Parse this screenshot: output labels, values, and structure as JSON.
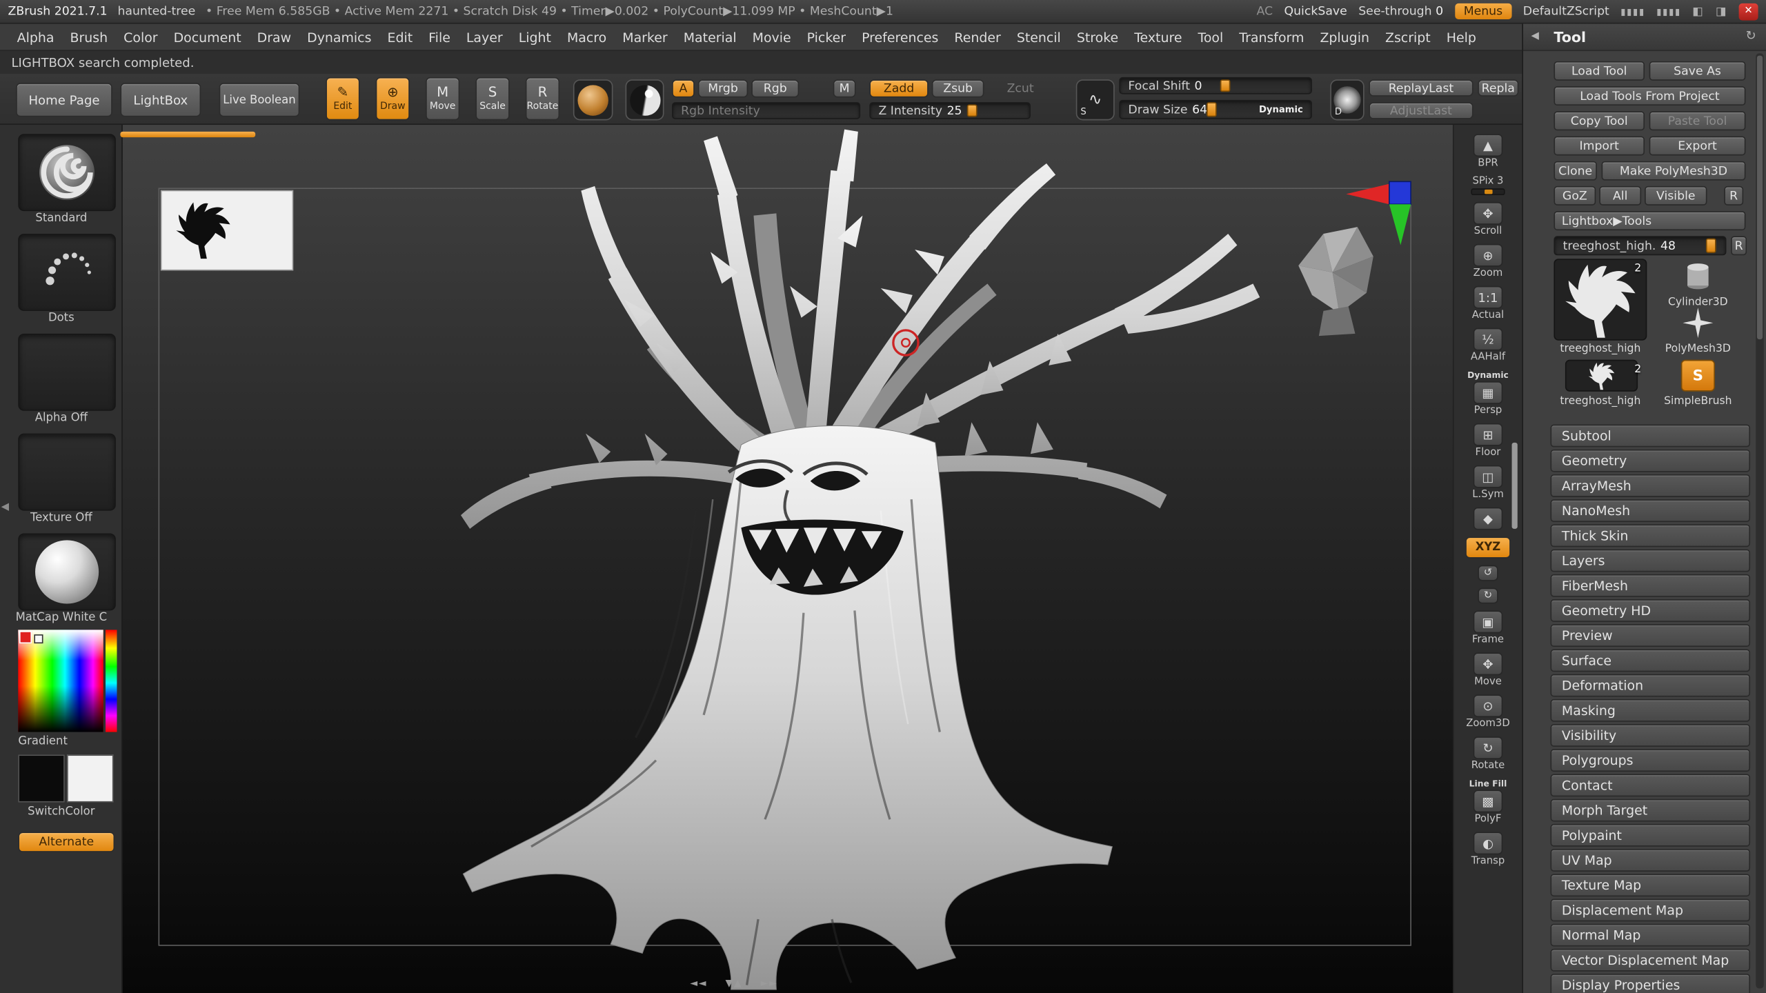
{
  "titlebar": {
    "app_name": "ZBrush 2021.7.1",
    "document_name": "haunted-tree",
    "stats": [
      "Free Mem 6.585GB",
      "Active Mem 2271",
      "Scratch Disk 49",
      "Timer▶0.002",
      "PolyCount▶11.099 MP",
      "MeshCount▶1"
    ],
    "ac": "AC",
    "quicksave": "QuickSave",
    "seethrough": "See-through",
    "seethrough_value": "0",
    "menus": "Menus",
    "zscript": "DefaultZScript",
    "window_icons": [
      "▮▮▮▮",
      "▮▮▮▮",
      "◧",
      "◨"
    ],
    "close_glyph": "✕"
  },
  "menubar": {
    "items": [
      "Alpha",
      "Brush",
      "Color",
      "Document",
      "Draw",
      "Dynamics",
      "Edit",
      "File",
      "Layer",
      "Light",
      "Macro",
      "Marker",
      "Material",
      "Movie",
      "Picker",
      "Preferences",
      "Render",
      "Stencil",
      "Stroke",
      "Texture",
      "Tool",
      "Transform",
      "Zplugin",
      "Zscript",
      "Help"
    ]
  },
  "statusbar": {
    "message": "LIGHTBOX search completed."
  },
  "shelf": {
    "home_page": "Home Page",
    "lightbox": "LightBox",
    "live_boolean": "Live Boolean",
    "modes": [
      {
        "label": "Edit",
        "glyph": "✎",
        "active": true
      },
      {
        "label": "Draw",
        "glyph": "⊕",
        "active": true
      },
      {
        "label": "Move",
        "glyph": "M",
        "active": false
      },
      {
        "label": "Scale",
        "glyph": "S",
        "active": false
      },
      {
        "label": "Rotate",
        "glyph": "R",
        "active": false
      }
    ],
    "a_label": "A",
    "mrgb": "Mrgb",
    "rgb": "Rgb",
    "m": "M",
    "zadd": "Zadd",
    "zsub": "Zsub",
    "zcut": "Zcut",
    "rgb_intensity_label": "Rgb Intensity",
    "z_intensity_label": "Z Intensity",
    "z_intensity_value": "25",
    "focal_shift_label": "Focal Shift",
    "focal_shift_value": "0",
    "draw_size_label": "Draw Size",
    "draw_size_value": "64",
    "dynamic_label": "Dynamic",
    "stroke_glyph": "∿",
    "stroke_badge": "S",
    "alpha_badge": "D",
    "replay_last": "ReplayLast",
    "replay_short": "Repla",
    "adjust_last": "AdjustLast"
  },
  "left_tray": {
    "brush_label": "Standard",
    "stroke_label": "Dots",
    "alpha_label": "Alpha Off",
    "texture_label": "Texture Off",
    "material_label": "MatCap White C",
    "gradient_label": "Gradient",
    "switchcolor_label": "SwitchColor",
    "alternate_label": "Alternate"
  },
  "canvas_extras": {
    "left_arrow": "◀",
    "nav_arrows": [
      "◄◄",
      "▼▲",
      "►►"
    ]
  },
  "right_shelf": {
    "items": [
      {
        "icon": "bpr-render-button",
        "label": "BPR",
        "glyph": "▲"
      },
      {
        "icon": "spix-slider",
        "label": "SPix 3",
        "kind": "slider"
      },
      {
        "icon": "scroll-hand-icon",
        "label": "Scroll",
        "glyph": "✥"
      },
      {
        "icon": "zoom-icon",
        "label": "Zoom",
        "glyph": "⊕"
      },
      {
        "icon": "actual-size-icon",
        "label": "Actual",
        "glyph": "1:1"
      },
      {
        "icon": "aa-half-icon",
        "label": "AAHalf",
        "glyph": "½"
      },
      {
        "icon": "perspective-icon",
        "label": "Persp",
        "top": "Dynamic",
        "glyph": "▦"
      },
      {
        "icon": "floor-grid-icon",
        "label": "Floor",
        "glyph": "⊞"
      },
      {
        "icon": "local-symmetry-icon",
        "label": "L.Sym",
        "glyph": "◫"
      },
      {
        "icon": "pivot-icon",
        "label": "",
        "glyph": "◆"
      },
      {
        "icon": "xyz-button",
        "label": "XYZ",
        "kind": "button",
        "active": true
      },
      {
        "icon": "rotate-ccw-icon",
        "label": "",
        "glyph": "↺",
        "small": true
      },
      {
        "icon": "rotate-cw-icon",
        "label": "",
        "glyph": "↻",
        "small": true
      },
      {
        "icon": "frame-icon",
        "label": "Frame",
        "glyph": "▣"
      },
      {
        "icon": "move-view-icon",
        "label": "Move",
        "glyph": "✥"
      },
      {
        "icon": "zoom3d-icon",
        "label": "Zoom3D",
        "glyph": "⊙"
      },
      {
        "icon": "rotate-view-icon",
        "label": "Rotate",
        "glyph": "↻"
      },
      {
        "icon": "polyframe-icon",
        "label": "PolyF",
        "top": "Line Fill",
        "glyph": "▩"
      },
      {
        "icon": "transparency-icon",
        "label": "Transp",
        "glyph": "◐"
      }
    ]
  },
  "tool_panel": {
    "title": "Tool",
    "collapse_glyph": "◀",
    "menu_glyph": "↻",
    "buttons": {
      "load_tool": "Load Tool",
      "save_as": "Save As",
      "load_tools_from_project": "Load Tools From Project",
      "copy_tool": "Copy Tool",
      "paste_tool": "Paste Tool",
      "import": "Import",
      "export": "Export",
      "clone": "Clone",
      "make_polymesh3d": "Make PolyMesh3D",
      "goz": "GoZ",
      "all": "All",
      "visible": "Visible",
      "r": "R",
      "lightbox_tools": "Lightbox▶Tools"
    },
    "active_slider": {
      "label": "treeghost_high.",
      "value": "48",
      "r_label": "R"
    },
    "tools": [
      {
        "name": "treeghost_high",
        "badge": "2",
        "kind": "tree",
        "slot": "big"
      },
      {
        "name": "Cylinder3D",
        "kind": "cylinder",
        "slot": "r1"
      },
      {
        "name": "PolyMesh3D",
        "kind": "star",
        "slot": "r2"
      },
      {
        "name": "treeghost_high",
        "badge": "2",
        "kind": "tree",
        "slot": "l2"
      },
      {
        "name": "SimpleBrush",
        "kind": "sbrush",
        "glyph": "S",
        "slot": "r3"
      }
    ],
    "sections": [
      "Subtool",
      "Geometry",
      "ArrayMesh",
      "NanoMesh",
      "Thick Skin",
      "Layers",
      "FiberMesh",
      "Geometry HD",
      "Preview",
      "Surface",
      "Deformation",
      "Masking",
      "Visibility",
      "Polygroups",
      "Contact",
      "Morph Target",
      "Polypaint",
      "UV Map",
      "Texture Map",
      "Displacement Map",
      "Normal Map",
      "Vector Displacement Map",
      "Display Properties"
    ]
  }
}
